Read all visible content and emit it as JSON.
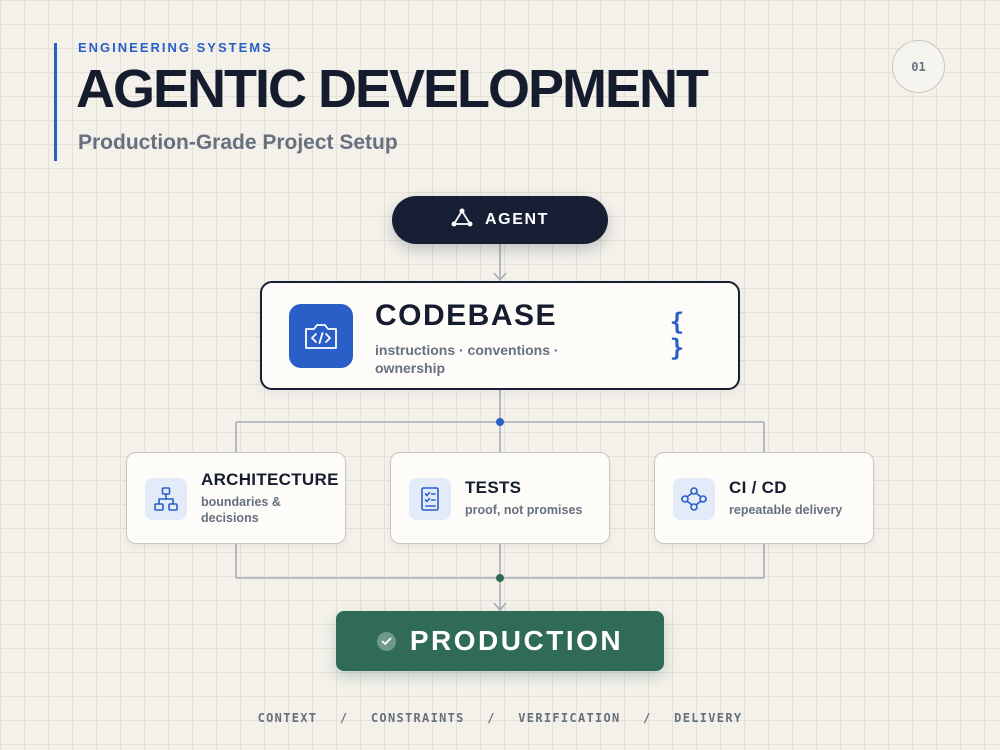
{
  "header": {
    "eyebrow": "ENGINEERING SYSTEMS",
    "title": "AGENTIC DEVELOPMENT",
    "subtitle": "Production-Grade Project Setup",
    "slide_number": "01"
  },
  "diagram": {
    "agent": {
      "label": "AGENT",
      "icon": "triangle-nodes-icon"
    },
    "codebase": {
      "title": "CODEBASE",
      "description": "instructions · conventions · ownership",
      "brace_open": "{",
      "brace_close": "}",
      "icon": "code-folder-icon"
    },
    "pillars": [
      {
        "title": "ARCHITECTURE",
        "description": "boundaries & decisions",
        "icon": "hierarchy-icon"
      },
      {
        "title": "TESTS",
        "description": "proof, not promises",
        "icon": "checklist-icon"
      },
      {
        "title": "CI / CD",
        "description": "repeatable delivery",
        "icon": "pipeline-icon"
      }
    ],
    "production": {
      "label": "PRODUCTION",
      "icon": "check-circle-icon"
    }
  },
  "footer": {
    "items": [
      "CONTEXT",
      "CONSTRAINTS",
      "VERIFICATION",
      "DELIVERY"
    ],
    "separator": "/"
  },
  "colors": {
    "background": "#f3f1ea",
    "navy": "#161f33",
    "accent_blue": "#2b5fc8",
    "production_green": "#2f6b56",
    "muted_text": "#66707f",
    "connector": "#a7aeb8"
  }
}
